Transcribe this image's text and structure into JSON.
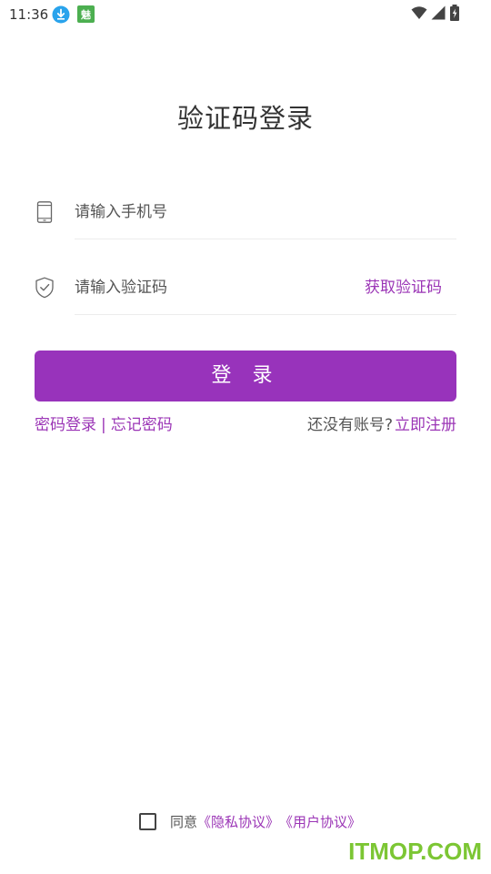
{
  "status_bar": {
    "time": "11:36",
    "app_icon_text": "魅"
  },
  "page": {
    "title": "验证码登录"
  },
  "phone_field": {
    "icon": "phone-icon",
    "placeholder": "请输入手机号",
    "value": ""
  },
  "code_field": {
    "icon": "shield-check-icon",
    "placeholder": "请输入验证码",
    "value": "",
    "get_code_label": "获取验证码"
  },
  "login_button": {
    "label": "登 录"
  },
  "links": {
    "password_login": "密码登录",
    "separator": "|",
    "forgot_password": "忘记密码",
    "no_account": "还没有账号?",
    "register": "立即注册"
  },
  "agreement": {
    "checked": false,
    "prefix": "同意",
    "privacy": "《隐私协议》",
    "user": "《用户协议》"
  },
  "watermark": {
    "text": "ITMOP.COM"
  },
  "colors": {
    "accent": "#9833bb",
    "link": "#9b35b6",
    "watermark": "#7cc634"
  }
}
